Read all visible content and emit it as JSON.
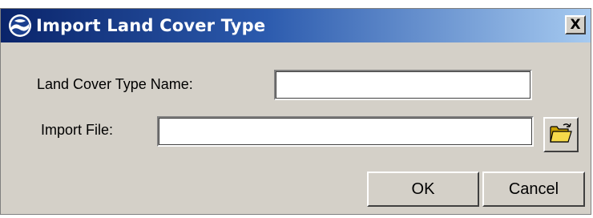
{
  "window": {
    "title": "Import Land Cover Type",
    "close_label": "X",
    "app_icon": "noaa-logo-icon"
  },
  "form": {
    "name_label": "Land Cover Type Name:",
    "name_value": "",
    "file_label": "Import File:",
    "file_value": "",
    "browse_icon": "open-folder-icon"
  },
  "buttons": {
    "ok_label": "OK",
    "cancel_label": "Cancel"
  },
  "colors": {
    "titlebar_start": "#0a246a",
    "titlebar_end": "#a6caf0",
    "dialog_bg": "#d4d0c8"
  }
}
